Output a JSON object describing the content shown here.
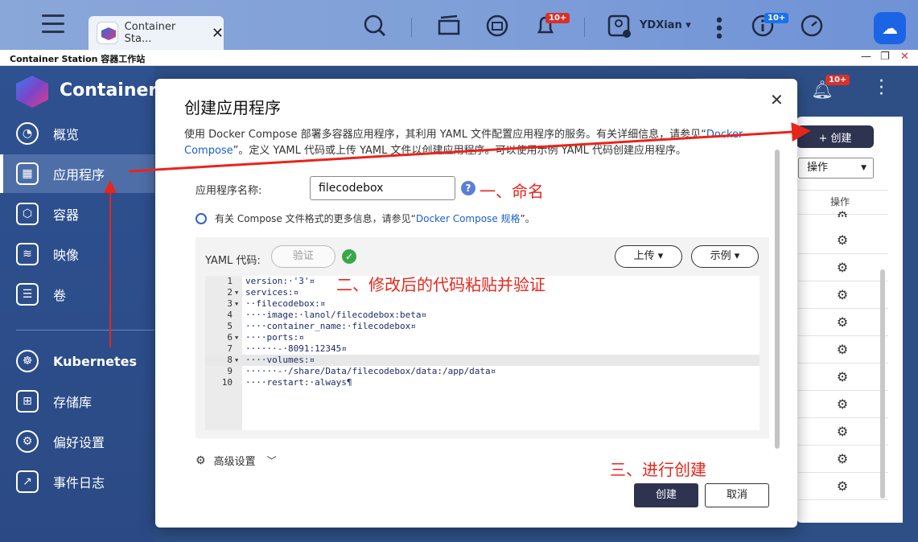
{
  "taskbar": {
    "tab_title": "Container Sta...",
    "notif_badge": "10+",
    "info_badge": "10+",
    "user_name": "YDXian ▾"
  },
  "window": {
    "title": "Container Station 容器工作站"
  },
  "sidebar": {
    "brand": "Container S",
    "items": [
      {
        "label": "概览"
      },
      {
        "label": "应用程序"
      },
      {
        "label": "容器"
      },
      {
        "label": "映像"
      },
      {
        "label": "卷"
      },
      {
        "label": "Kubernetes"
      },
      {
        "label": "存储库"
      },
      {
        "label": "偏好设置"
      },
      {
        "label": "事件日志"
      }
    ]
  },
  "background": {
    "bell_badge": "10+",
    "create_button": "+ 创建",
    "op_select": "操作",
    "op_header": "操作"
  },
  "modal": {
    "title": "创建应用程序",
    "desc_text": "使用 Docker Compose 部署多容器应用程序，其利用 YAML 文件配置应用程序的服务。有关详细信息，请参见“",
    "desc_link": "Docker Compose",
    "desc_tail": "”。定义 YAML 代码或上传 YAML 文件以创建应用程序。可以使用示例 YAML 代码创建应用程序。",
    "name_label": "应用程序名称:",
    "name_value": "filecodebox",
    "info_text": "有关 Compose 文件格式的更多信息，请参见“",
    "info_link": "Docker Compose 规格",
    "info_tail": "”。",
    "yaml_label": "YAML 代码:",
    "verify_button": "验证",
    "upload_button": "上传 ▾",
    "example_button": "示例 ▾",
    "code_lines": [
      "version:·'3'¤",
      "services:¤",
      "··filecodebox:¤",
      "····image:·lanol/filecodebox:beta¤",
      "····container_name:·filecodebox¤",
      "····ports:¤",
      "······-·8091:12345¤",
      "····volumes:¤",
      "······-·/share/Data/filecodebox/data:/app/data¤",
      "····restart:·always¶"
    ],
    "line_numbers": [
      "1",
      "2",
      "3",
      "4",
      "5",
      "6",
      "7",
      "8",
      "9",
      "10"
    ],
    "advanced_label": "高级设置",
    "create_button": "创建",
    "cancel_button": "取消"
  },
  "annotations": {
    "step1": "一、命名",
    "step2": "二、修改后的代码粘贴并验证",
    "step3": "三、进行创建",
    "color": "#e8251b"
  }
}
